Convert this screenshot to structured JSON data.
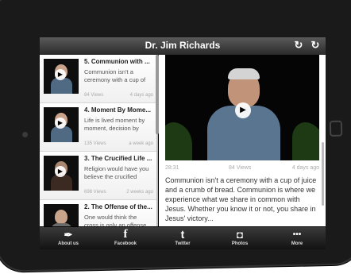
{
  "header": {
    "title": "Dr. Jim Richards"
  },
  "list": [
    {
      "title": "5. Communion with ...",
      "desc": "Communion isn't a ceremony with a cup of",
      "views": "84 Views",
      "age": "4 days ago"
    },
    {
      "title": "4. Moment By Mome...",
      "desc": "Life is lived moment by moment, decision by",
      "views": "135 Views",
      "age": "a week ago"
    },
    {
      "title": "3. The Crucified Life ...",
      "desc": "Religion would have you believe the crucified",
      "views": "698 Views",
      "age": "2 weeks ago"
    },
    {
      "title": "2. The Offense of the...",
      "desc": "One would think the cross is only an offense",
      "views": "",
      "age": ""
    }
  ],
  "detail": {
    "duration": "28:31",
    "views": "84 Views",
    "age": "4 days ago",
    "description": "Communion isn't a ceremony with a cup of juice and a crumb of bread. Communion is where we experience what we share in common with Jesus. Whether you know it or not, you share in Jesus' victory..."
  },
  "tabs": [
    {
      "label": "About us",
      "icon": "quill-icon",
      "glyph": "✒"
    },
    {
      "label": "Facebook",
      "icon": "facebook-icon",
      "glyph": "f"
    },
    {
      "label": "Twitter",
      "icon": "twitter-icon",
      "glyph": "t"
    },
    {
      "label": "Photos",
      "icon": "camera-icon",
      "glyph": "◘"
    },
    {
      "label": "More",
      "icon": "more-icon",
      "glyph": "•••"
    }
  ]
}
